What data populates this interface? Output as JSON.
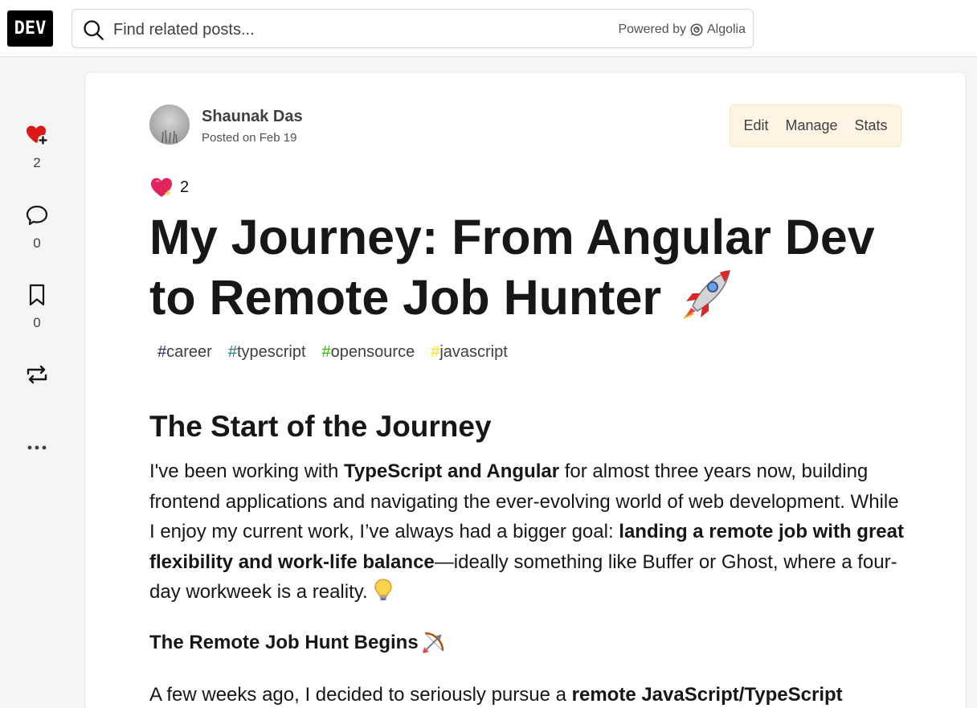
{
  "header": {
    "logo_text": "DEV",
    "search_placeholder": "Find related posts...",
    "powered_by": "Powered by",
    "algolia": "Algolia"
  },
  "rail": {
    "like_count": "2",
    "comment_count": "0",
    "bookmark_count": "0"
  },
  "post": {
    "author": "Shaunak Das",
    "posted": "Posted on Feb 19",
    "actions": {
      "edit": "Edit",
      "manage": "Manage",
      "stats": "Stats"
    },
    "reaction_count": "2",
    "title": "My Journey: From Angular Dev to Remote Job Hunter",
    "tags": [
      {
        "hash": "#",
        "name": "career",
        "color": "#2a2566"
      },
      {
        "hash": "#",
        "name": "typescript",
        "color": "#2b7489"
      },
      {
        "hash": "#",
        "name": "opensource",
        "color": "#26be00"
      },
      {
        "hash": "#",
        "name": "javascript",
        "color": "#f7df1e"
      }
    ],
    "section_heading": "The Start of the Journey",
    "p1": {
      "a": "I've been working with ",
      "b": "TypeScript and Angular",
      "c": " for almost three years now, building frontend applications and navigating the ever-evolving world of web development. While I enjoy my current work, I’ve always had a bigger goal: ",
      "d": "landing a remote job with great flexibility and work-life balance",
      "e": "—ideally something like Buffer or Ghost, where a four-day workweek is a reality. "
    },
    "subheading": "The Remote Job Hunt Begins",
    "p2": {
      "a": "A few weeks ago, I decided to seriously pursue a ",
      "b": "remote JavaScript/TypeScript"
    }
  },
  "colors": {
    "accent_heart": "#dc1818",
    "owner_bg": "#fdf4e3"
  }
}
